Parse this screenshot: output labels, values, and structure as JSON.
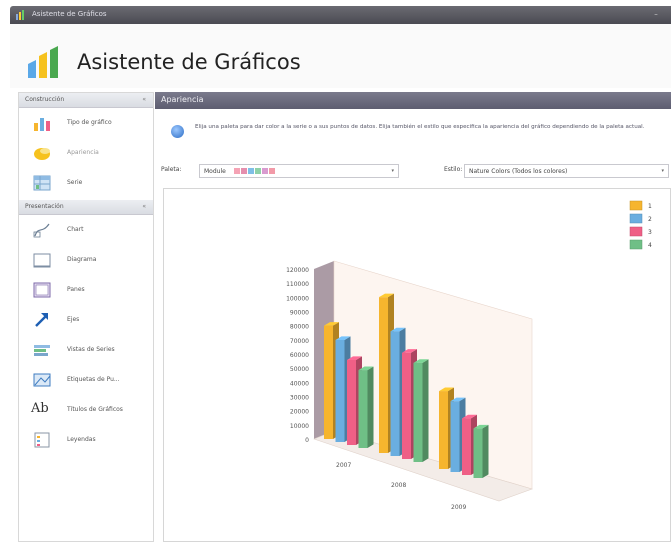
{
  "window": {
    "title": "Asistente de Gráficos",
    "heading": "Asistente de Gráficos",
    "minimize": "–"
  },
  "sidebar": {
    "construccion": {
      "title": "Construcción",
      "chevron": "«",
      "items": [
        {
          "label": "Tipo de gráfico",
          "icon": "bar-chart-icon"
        },
        {
          "label": "Apariencia",
          "icon": "palette-icon"
        },
        {
          "label": "Serie",
          "icon": "series-grid-icon"
        }
      ]
    },
    "presentacion": {
      "title": "Presentación",
      "chevron": "«",
      "items": [
        {
          "label": "Chart",
          "icon": "chart-drawing-icon"
        },
        {
          "label": "Diagrama",
          "icon": "diagram-icon"
        },
        {
          "label": "Panes",
          "icon": "panes-icon"
        },
        {
          "label": "Ejes",
          "icon": "axis-arrow-icon"
        },
        {
          "label": "Vistas de Series",
          "icon": "series-views-icon"
        },
        {
          "label": "Etiquetas de Pu...",
          "icon": "point-labels-icon"
        },
        {
          "label": "Títulos de Gráficos",
          "icon": "chart-titles-icon"
        },
        {
          "label": "Leyendas",
          "icon": "legend-icon"
        }
      ]
    }
  },
  "main": {
    "section_title": "Apariencia",
    "info_text": "Elija una paleta para dar color a la serie o a sus puntos de datos. Elija también el estilo que especifica la apariencia del gráfico dependiendo de la paleta actual.",
    "palette_label": "Paleta:",
    "palette_value": "Module",
    "palette_colors": [
      "#f5a3b5",
      "#e58fae",
      "#7fbfe6",
      "#8ed1a8",
      "#d99bd0",
      "#f29aa8"
    ],
    "style_label": "Estilo:",
    "style_value": "Nature Colors (Todos los colores)"
  },
  "chart_data": {
    "type": "bar",
    "categories": [
      "2007",
      "2008",
      "2009"
    ],
    "series": [
      {
        "name": "1",
        "color": "#f6b52e",
        "values": [
          80000,
          110000,
          55000
        ]
      },
      {
        "name": "2",
        "color": "#6aaee0",
        "values": [
          72000,
          88000,
          50000
        ]
      },
      {
        "name": "3",
        "color": "#ef5f86",
        "values": [
          60000,
          75000,
          40000
        ]
      },
      {
        "name": "4",
        "color": "#6fbf86",
        "values": [
          55000,
          70000,
          35000
        ]
      }
    ],
    "y_ticks": [
      "120000",
      "110000",
      "100000",
      "90000",
      "80000",
      "70000",
      "60000",
      "50000",
      "40000",
      "30000",
      "20000",
      "10000",
      "0"
    ],
    "ylim": [
      0,
      120000
    ],
    "legend_position": "top-right",
    "perspective": "3d"
  }
}
